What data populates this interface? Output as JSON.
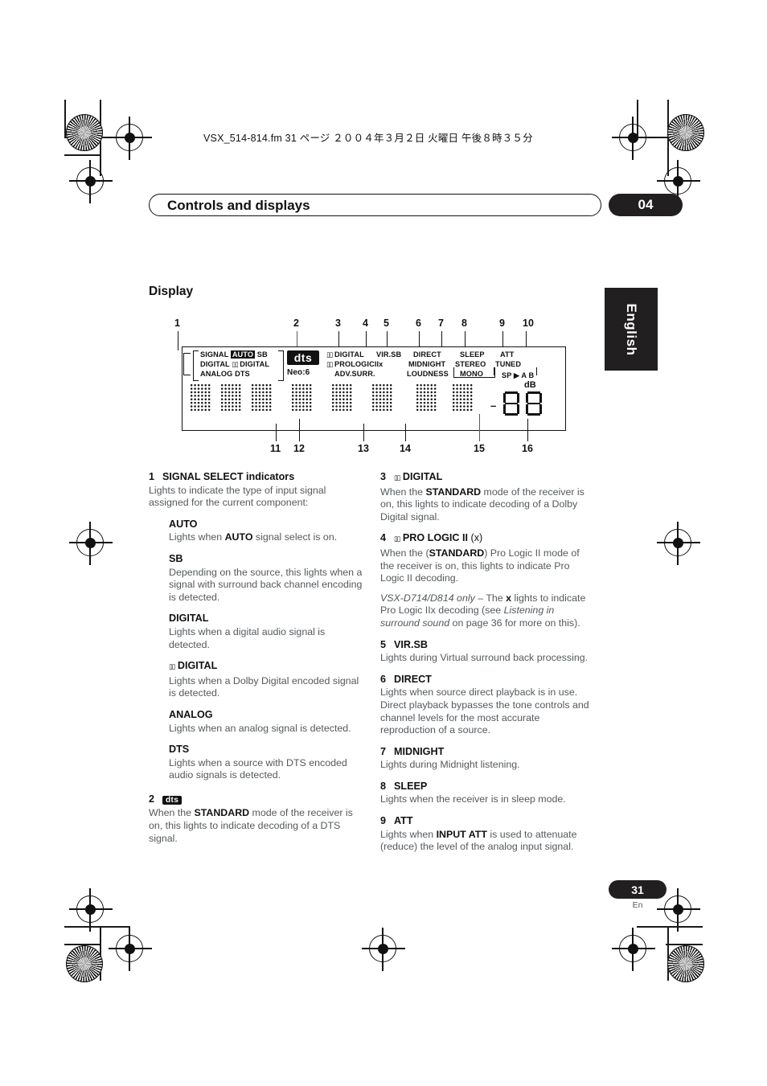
{
  "header": {
    "file_line": "VSX_514-814.fm  31 ページ  ２００４年３月２日  火曜日  午後８時３５分"
  },
  "chapter": {
    "title": "Controls and displays",
    "number": "04"
  },
  "side_tab": {
    "label": "English"
  },
  "section": {
    "heading": "Display"
  },
  "diagram": {
    "callouts_top": [
      "1",
      "2",
      "3",
      "4",
      "5",
      "6",
      "7",
      "8",
      "9",
      "10"
    ],
    "callouts_bottom": [
      "11",
      "12",
      "13",
      "14",
      "15",
      "16"
    ],
    "indicators": {
      "signal_block": [
        "SIGNAL",
        "AUTO",
        "SB",
        "DIGITAL",
        "DIGITAL",
        "ANALOG",
        "DTS"
      ],
      "dts_logo": "dts",
      "neo6": "Neo:6",
      "dolby_digital": "DIGITAL",
      "prologic": "PROLOGIC",
      "prologic_suffix": "IIx",
      "adv_surr": "ADV.SURR.",
      "vir_sb": "VIR.SB",
      "direct": "DIRECT",
      "midnight": "MIDNIGHT",
      "loudness": "LOUDNESS",
      "sleep": "SLEEP",
      "stereo": "STEREO",
      "mono": "MONO",
      "att": "ATT",
      "tuned": "TUNED",
      "speakers": "SP ▶ A B",
      "db": "dB",
      "minus": "–"
    }
  },
  "left_column": [
    {
      "num": "1",
      "title": "SIGNAL SELECT indicators",
      "body": "Lights to indicate the type of input signal assigned for the current component:",
      "subitems": [
        {
          "title": "AUTO",
          "body_pre": "Lights when ",
          "body_bold": "AUTO",
          "body_post": " signal select is on."
        },
        {
          "title": "SB",
          "body": "Depending on the source, this lights when a signal with surround back channel encoding is detected."
        },
        {
          "title": "DIGITAL",
          "body": "Lights when a digital audio signal is detected."
        },
        {
          "title": "DIGITAL",
          "title_prefix_logo": "dolby",
          "body": "Lights when a Dolby Digital encoded signal is detected."
        },
        {
          "title": "ANALOG",
          "body": "Lights when an analog signal is detected."
        },
        {
          "title": "DTS",
          "body": "Lights when a source with DTS encoded audio signals is detected."
        }
      ]
    },
    {
      "num": "2",
      "title_logo": "dts",
      "body_pre": "When the ",
      "body_bold": "STANDARD",
      "body_post": " mode of the receiver is on, this lights to indicate decoding of a DTS signal."
    }
  ],
  "right_column": [
    {
      "num": "3",
      "title": "DIGITAL",
      "title_prefix_logo": "dolby",
      "body_pre": "When the ",
      "body_bold": "STANDARD",
      "body_post": " mode of the receiver is on, this lights to indicate decoding of a Dolby Digital signal."
    },
    {
      "num": "4",
      "title": "PRO LOGIC II",
      "title_prefix_logo": "dolby",
      "title_suffix": "(x)",
      "body_pre": "When the (",
      "body_bold": "STANDARD",
      "body_post": ") Pro Logic II mode of the receiver is on, this lights to indicate Pro Logic II decoding.",
      "note_italic_1": "VSX-D714/D814 only",
      "note_mid_1": " – The ",
      "note_bold": "x",
      "note_mid_2": " lights to indicate Pro Logic IIx decoding (see ",
      "note_italic_2": "Listening in surround sound",
      "note_mid_3": " on page 36 for more on this)."
    },
    {
      "num": "5",
      "title": "VIR.SB",
      "body": "Lights during Virtual surround back processing."
    },
    {
      "num": "6",
      "title": "DIRECT",
      "body": "Lights when source direct playback is in use. Direct playback bypasses the tone controls and channel levels for the most accurate reproduction of a source."
    },
    {
      "num": "7",
      "title": "MIDNIGHT",
      "body": "Lights during Midnight listening."
    },
    {
      "num": "8",
      "title": "SLEEP",
      "body": "Lights when the receiver is in sleep mode."
    },
    {
      "num": "9",
      "title": "ATT",
      "body_pre": "Lights when ",
      "body_bold": "INPUT ATT",
      "body_post": " is used to attenuate (reduce) the level of the analog input signal."
    }
  ],
  "footer": {
    "page_number": "31",
    "language": "En"
  }
}
